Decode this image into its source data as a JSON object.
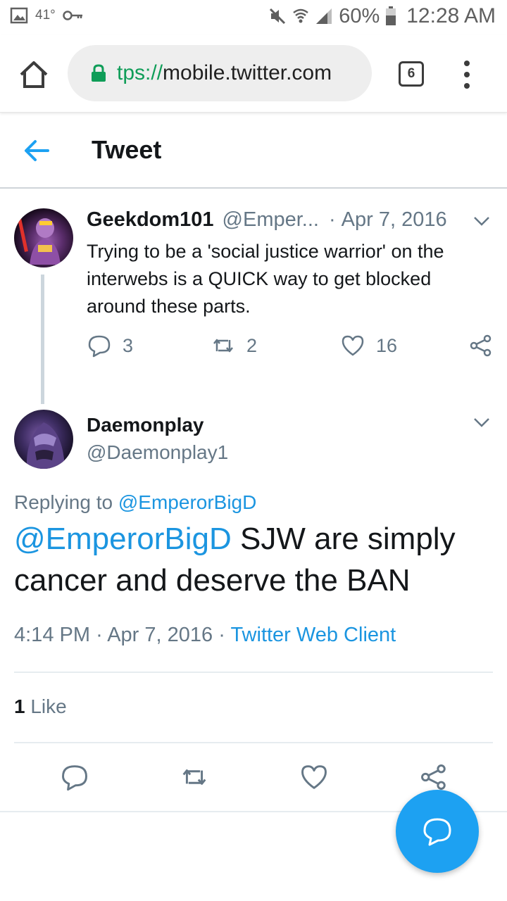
{
  "status_bar": {
    "temperature": "41°",
    "battery": "60%",
    "time": "12:28 AM"
  },
  "browser": {
    "url_scheme": "tps://",
    "url_host": "mobile.twitter.com",
    "tab_count": "6"
  },
  "header": {
    "title": "Tweet"
  },
  "tweet1": {
    "name": "Geekdom101",
    "handle": "@Emper...",
    "separator": "·",
    "date": "Apr 7, 2016",
    "text": "Trying to be a 'social justice warrior' on the interwebs is a QUICK way to get blocked around these parts.",
    "replies": "3",
    "retweets": "2",
    "likes": "16"
  },
  "tweet2": {
    "name": "Daemonplay",
    "handle": "@Daemonplay1",
    "replying_label": "Replying to",
    "replying_mention": "@EmperorBigD",
    "text_mention": "@EmperorBigD",
    "text_body": " SJW are simply cancer and deserve the BAN",
    "time": "4:14 PM",
    "separator": "·",
    "date": "Apr 7, 2016",
    "client": "Twitter Web Client",
    "like_count": "1",
    "like_label": "Like"
  },
  "colors": {
    "accent": "#1da1f2",
    "link": "#1b95e0",
    "secondary_text": "#657786"
  }
}
